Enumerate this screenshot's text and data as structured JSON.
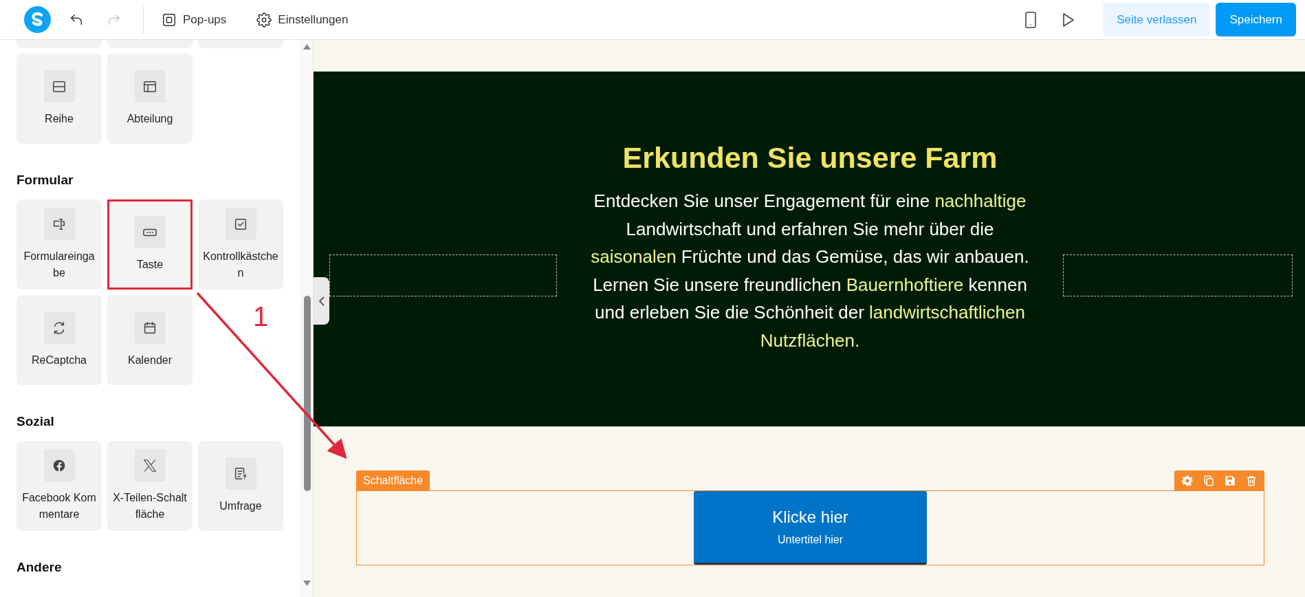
{
  "toolbar": {
    "history": [
      {
        "kind": "undo",
        "disabled": false
      },
      {
        "kind": "redo",
        "disabled": true
      }
    ],
    "menu": [
      {
        "kind": "popups",
        "label": "Pop-ups"
      },
      {
        "kind": "settings",
        "label": "Einstellungen"
      }
    ],
    "tools": [
      {
        "kind": "device"
      },
      {
        "kind": "preview"
      }
    ],
    "buttons": [
      {
        "kind": "secondary",
        "label": "Seite verlassen"
      },
      {
        "kind": "primary",
        "label": "Speichern"
      }
    ]
  },
  "sidebar": {
    "sections": [
      {
        "tiles": [
          {
            "kind": "clipped"
          },
          {
            "kind": "clipped"
          },
          {
            "kind": "clipped"
          },
          {
            "kind": "row",
            "label": "Reihe",
            "highlighted": false
          },
          {
            "kind": "layout",
            "label": "Abteilung",
            "highlighted": false
          }
        ]
      },
      {
        "title": "Formular",
        "tiles": [
          {
            "kind": "input",
            "label": "Formulareingabe",
            "highlighted": false
          },
          {
            "kind": "button",
            "label": "Taste",
            "highlighted": true
          },
          {
            "kind": "checkbox",
            "label": "Kontrollkästchen",
            "highlighted": false
          },
          {
            "kind": "recaptcha",
            "label": "ReCaptcha",
            "highlighted": false
          },
          {
            "kind": "calendar",
            "label": "Kalender",
            "highlighted": false
          }
        ]
      },
      {
        "title": "Sozial",
        "tiles": [
          {
            "kind": "facebook",
            "label": "Facebook Kommentare",
            "highlighted": false
          },
          {
            "kind": "x",
            "label": "X-Teilen-Schaltfläche",
            "highlighted": false
          },
          {
            "kind": "poll",
            "label": "Umfrage",
            "highlighted": false
          }
        ]
      },
      {
        "title": "Andere"
      }
    ]
  },
  "canvas": {
    "hero": {
      "title": "Erkunden Sie unsere Farm",
      "paragraph": [
        {
          "text": "Entdecken Sie unser Engagement für eine ",
          "highlight": false
        },
        {
          "text": "nachhaltige",
          "highlight": true
        },
        {
          "text": " Landwirtschaft und erfahren Sie mehr über die ",
          "highlight": false
        },
        {
          "text": "saisonalen",
          "highlight": true
        },
        {
          "text": " Früchte und das Gemüse, das wir anbauen. Lernen Sie unsere freundlichen ",
          "highlight": false
        },
        {
          "text": "Bauernhoftiere",
          "highlight": true
        },
        {
          "text": " kennen und erleben Sie die Schönheit der ",
          "highlight": false
        },
        {
          "text": "landwirtschaftlichen Nutzflächen.",
          "highlight": true
        }
      ]
    },
    "element": {
      "tag": "Schaltfläche",
      "selected": true,
      "button": {
        "title": "Klicke hier",
        "subtitle": "Untertitel hier"
      }
    }
  },
  "annotation": {
    "label": "1"
  }
}
